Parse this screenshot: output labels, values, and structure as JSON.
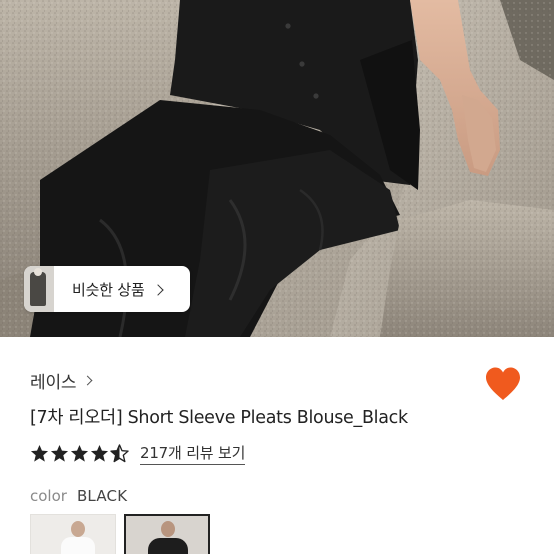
{
  "similar": {
    "label": "비슷한 상품"
  },
  "product": {
    "brand": "레이스",
    "title": "[7차 리오더] Short Sleeve Pleats Blouse_Black",
    "rating": 4.5,
    "reviews_label": "217개 리뷰 보기",
    "color_label": "color",
    "color_value": "BLACK"
  },
  "colors": {
    "heart": "#f05a1e",
    "star": "#222222"
  },
  "icons": {
    "wishlist": "heart-icon",
    "brand_chevron": "chevron-right-icon",
    "similar_chevron": "chevron-right-icon",
    "rating": "star-icon"
  }
}
